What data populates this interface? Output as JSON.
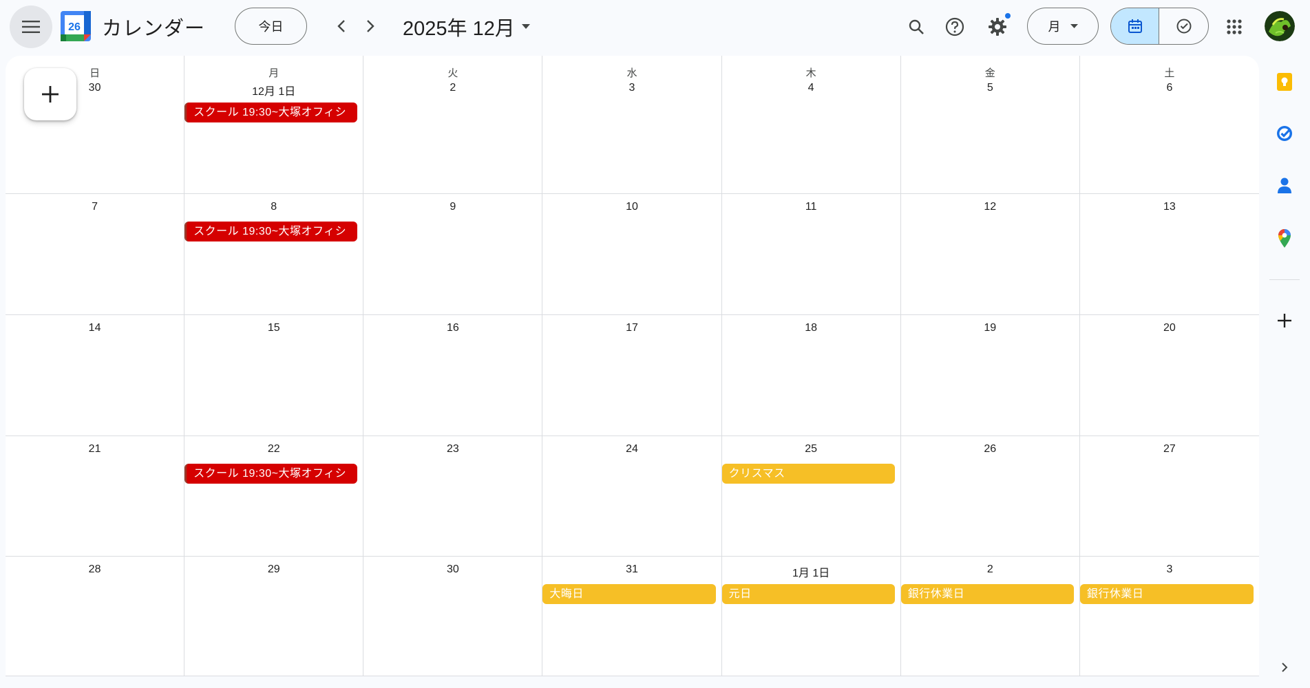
{
  "app": {
    "title": "カレンダー",
    "logo_day": "26"
  },
  "toolbar": {
    "today_label": "今日",
    "month_label": "2025年 12月",
    "view_label": "月"
  },
  "calendar": {
    "weekdays": [
      "日",
      "月",
      "火",
      "水",
      "木",
      "金",
      "土"
    ],
    "weeks": [
      [
        {
          "day": "30",
          "events": []
        },
        {
          "day": "12月 1日",
          "events": [
            {
              "title": "スクール 19:30~大塚オフィシ",
              "color": "red"
            }
          ]
        },
        {
          "day": "2",
          "events": []
        },
        {
          "day": "3",
          "events": []
        },
        {
          "day": "4",
          "events": []
        },
        {
          "day": "5",
          "events": []
        },
        {
          "day": "6",
          "events": []
        }
      ],
      [
        {
          "day": "7",
          "events": []
        },
        {
          "day": "8",
          "events": [
            {
              "title": "スクール 19:30~大塚オフィシ",
              "color": "red"
            }
          ]
        },
        {
          "day": "9",
          "events": []
        },
        {
          "day": "10",
          "events": []
        },
        {
          "day": "11",
          "events": []
        },
        {
          "day": "12",
          "events": []
        },
        {
          "day": "13",
          "events": []
        }
      ],
      [
        {
          "day": "14",
          "events": []
        },
        {
          "day": "15",
          "events": []
        },
        {
          "day": "16",
          "events": []
        },
        {
          "day": "17",
          "events": []
        },
        {
          "day": "18",
          "events": []
        },
        {
          "day": "19",
          "events": []
        },
        {
          "day": "20",
          "events": []
        }
      ],
      [
        {
          "day": "21",
          "events": []
        },
        {
          "day": "22",
          "events": [
            {
              "title": "スクール 19:30~大塚オフィシ",
              "color": "red"
            }
          ]
        },
        {
          "day": "23",
          "events": []
        },
        {
          "day": "24",
          "events": []
        },
        {
          "day": "25",
          "events": [
            {
              "title": "クリスマス",
              "color": "yellow"
            }
          ]
        },
        {
          "day": "26",
          "events": []
        },
        {
          "day": "27",
          "events": []
        }
      ],
      [
        {
          "day": "28",
          "events": []
        },
        {
          "day": "29",
          "events": []
        },
        {
          "day": "30",
          "events": []
        },
        {
          "day": "31",
          "events": [
            {
              "title": "大晦日",
              "color": "yellow"
            }
          ]
        },
        {
          "day": "1月 1日",
          "events": [
            {
              "title": "元日",
              "color": "yellow"
            }
          ]
        },
        {
          "day": "2",
          "events": [
            {
              "title": "銀行休業日",
              "color": "yellow"
            }
          ]
        },
        {
          "day": "3",
          "events": [
            {
              "title": "銀行休業日",
              "color": "yellow"
            }
          ]
        }
      ]
    ]
  },
  "colors": {
    "event_red": "#d50000",
    "holiday_yellow": "#f6bf26",
    "selected_view": "#c2e7ff"
  },
  "side_panel": {
    "icons": [
      "keep-icon",
      "tasks-icon",
      "contacts-icon",
      "maps-icon",
      "add-icon",
      "expand-icon"
    ]
  }
}
